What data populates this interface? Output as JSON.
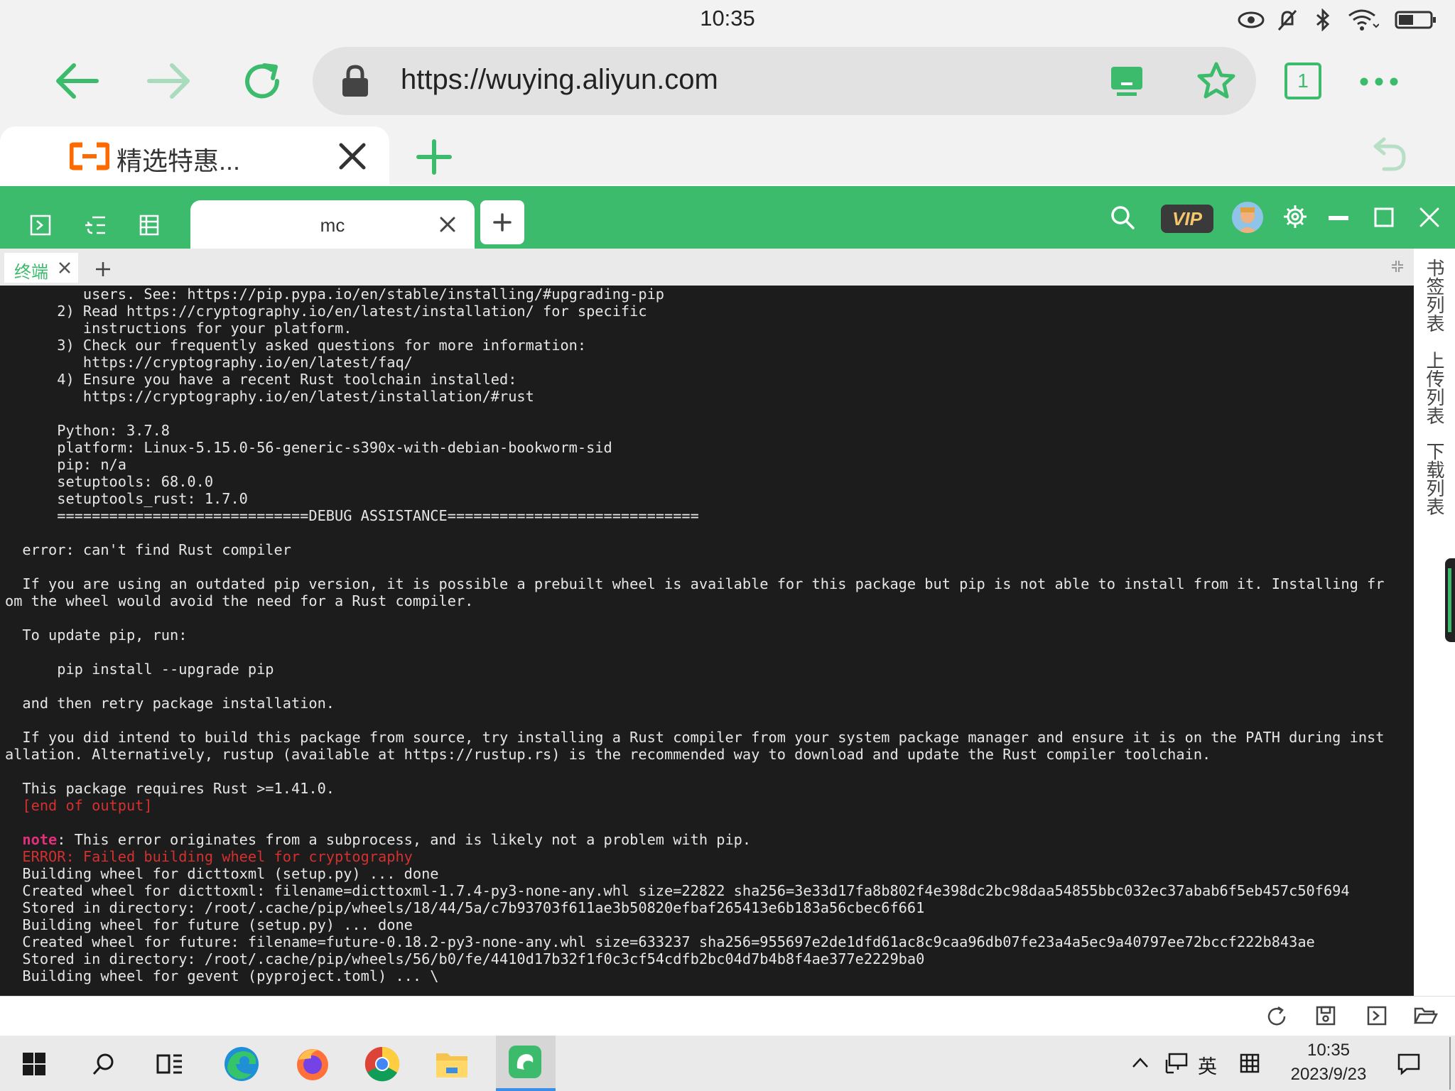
{
  "status_bar": {
    "time": "10:35"
  },
  "browser": {
    "url": "https://wuying.aliyun.com",
    "tab_count": "1",
    "tab_title": "精选特惠..."
  },
  "app": {
    "session_tab_title": "mc",
    "vip_label": "VIP",
    "terminal_tab_label": "终端"
  },
  "side_panel": {
    "bookmarks": "书签列表",
    "uploads": "上传列表",
    "downloads": "下载列表"
  },
  "terminal": {
    "lines": [
      {
        "text": "         users. See: https://pip.pypa.io/en/stable/installing/#upgrading-pip",
        "style": ""
      },
      {
        "text": "      2) Read https://cryptography.io/en/latest/installation/ for specific",
        "style": ""
      },
      {
        "text": "         instructions for your platform.",
        "style": ""
      },
      {
        "text": "      3) Check our frequently asked questions for more information:",
        "style": ""
      },
      {
        "text": "         https://cryptography.io/en/latest/faq/",
        "style": ""
      },
      {
        "text": "      4) Ensure you have a recent Rust toolchain installed:",
        "style": ""
      },
      {
        "text": "         https://cryptography.io/en/latest/installation/#rust",
        "style": ""
      },
      {
        "text": "",
        "style": ""
      },
      {
        "text": "      Python: 3.7.8",
        "style": ""
      },
      {
        "text": "      platform: Linux-5.15.0-56-generic-s390x-with-debian-bookworm-sid",
        "style": ""
      },
      {
        "text": "      pip: n/a",
        "style": ""
      },
      {
        "text": "      setuptools: 68.0.0",
        "style": ""
      },
      {
        "text": "      setuptools_rust: 1.7.0",
        "style": ""
      },
      {
        "text": "      =============================DEBUG ASSISTANCE=============================",
        "style": ""
      },
      {
        "text": "",
        "style": ""
      },
      {
        "text": "  error: can't find Rust compiler",
        "style": ""
      },
      {
        "text": "",
        "style": ""
      },
      {
        "text": "  If you are using an outdated pip version, it is possible a prebuilt wheel is available for this package but pip is not able to install from it. Installing fr",
        "style": ""
      },
      {
        "text": "om the wheel would avoid the need for a Rust compiler.",
        "style": ""
      },
      {
        "text": "",
        "style": ""
      },
      {
        "text": "  To update pip, run:",
        "style": ""
      },
      {
        "text": "",
        "style": ""
      },
      {
        "text": "      pip install --upgrade pip",
        "style": ""
      },
      {
        "text": "",
        "style": ""
      },
      {
        "text": "  and then retry package installation.",
        "style": ""
      },
      {
        "text": "",
        "style": ""
      },
      {
        "text": "  If you did intend to build this package from source, try installing a Rust compiler from your system package manager and ensure it is on the PATH during inst",
        "style": ""
      },
      {
        "text": "allation. Alternatively, rustup (available at https://rustup.rs) is the recommended way to download and update the Rust compiler toolchain.",
        "style": ""
      },
      {
        "text": "",
        "style": ""
      },
      {
        "text": "  This package requires Rust >=1.41.0.",
        "style": ""
      },
      {
        "text": "  [end of output]",
        "style": "red"
      },
      {
        "text": "",
        "style": ""
      },
      {
        "text": ": This error originates from a subprocess, and is likely not a problem with pip.",
        "style": "note",
        "prefix": "note"
      },
      {
        "text": "ERROR: Failed building wheel for cryptography",
        "style": "red"
      },
      {
        "text": "Building wheel for dicttoxml (setup.py) ... done",
        "style": ""
      },
      {
        "text": "Created wheel for dicttoxml: filename=dicttoxml-1.7.4-py3-none-any.whl size=22822 sha256=3e33d17fa8b802f4e398dc2bc98daa54855bbc032ec37abab6f5eb457c50f694",
        "style": ""
      },
      {
        "text": "Stored in directory: /root/.cache/pip/wheels/18/44/5a/c7b93703f611ae3b50820efbaf265413e6b183a56cbec6f661",
        "style": ""
      },
      {
        "text": "Building wheel for future (setup.py) ... done",
        "style": ""
      },
      {
        "text": "Created wheel for future: filename=future-0.18.2-py3-none-any.whl size=633237 sha256=955697e2de1dfd61ac8c9caa96db07fe23a4a5ec9a40797ee72bccf222b843ae",
        "style": ""
      },
      {
        "text": "Stored in directory: /root/.cache/pip/wheels/56/b0/fe/4410d17b32f1f0c3cf54cdfb2bc04d7b4b8f4ae377e2229ba0",
        "style": ""
      },
      {
        "text": "Building wheel for gevent (pyproject.toml) ... \\",
        "style": ""
      }
    ]
  },
  "taskbar": {
    "ime": "英",
    "time": "10:35",
    "date": "2023/9/23"
  },
  "colors": {
    "accent": "#3dbb6d",
    "terminal_bg": "#1c1c1c",
    "error_red": "#d33030",
    "note_pink": "#e0307a"
  },
  "icons": {
    "status": [
      "eye-icon",
      "mute-icon",
      "bluetooth-icon",
      "wifi-icon",
      "battery-icon"
    ],
    "browser": [
      "back-arrow-icon",
      "forward-arrow-icon",
      "reload-icon",
      "lock-icon",
      "cast-icon",
      "star-icon",
      "more-icon",
      "close-icon",
      "plus-icon",
      "undo-icon"
    ],
    "app": [
      "terminal-icon",
      "tree-icon",
      "list-icon",
      "search-icon",
      "avatar",
      "gear-icon",
      "minimize-icon",
      "maximize-icon",
      "close-icon"
    ],
    "bottom": [
      "refresh-icon",
      "save-icon",
      "terminal-icon",
      "folder-open-icon"
    ],
    "taskbar": [
      "windows-start-icon",
      "search-icon",
      "task-view-icon",
      "edge-icon",
      "firefox-icon",
      "chrome-icon",
      "file-explorer-icon",
      "app-icon",
      "chevron-up-icon",
      "network-icon",
      "keyboard-grid-icon",
      "notification-icon"
    ]
  }
}
